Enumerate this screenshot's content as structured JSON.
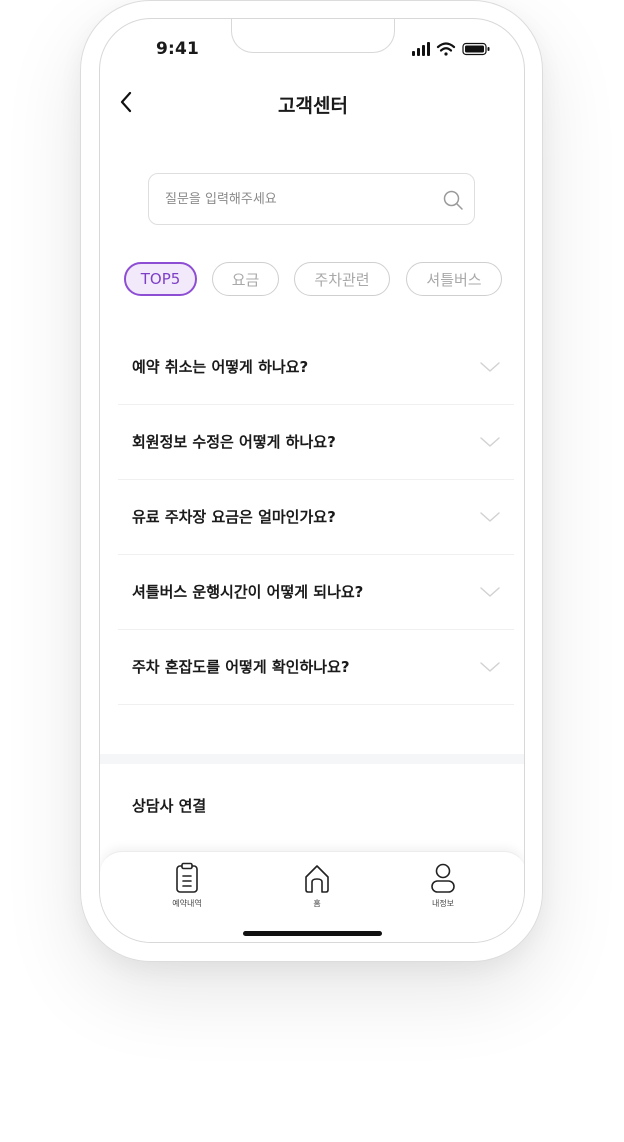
{
  "status_bar": {
    "time": "9:41"
  },
  "header": {
    "title": "고객센터"
  },
  "search": {
    "placeholder": "질문을 입력해주세요"
  },
  "chips": [
    {
      "label": "TOP5",
      "active": true
    },
    {
      "label": "요금",
      "active": false
    },
    {
      "label": "주차관련",
      "active": false
    },
    {
      "label": "셔틀버스",
      "active": false
    }
  ],
  "faqs": [
    {
      "question": "예약 취소는 어떻게 하나요?"
    },
    {
      "question": "회원정보 수정은 어떻게 하나요?"
    },
    {
      "question": "유료 주차장 요금은 얼마인가요?"
    },
    {
      "question": "셔틀버스 운행시간이 어떻게 되나요?"
    },
    {
      "question": "주차 혼잡도를 어떻게 확인하나요?"
    }
  ],
  "counselor": {
    "label": "상담사 연결"
  },
  "tab_bar": {
    "items": [
      {
        "label": "예약내역",
        "icon": "clipboard-icon"
      },
      {
        "label": "홈",
        "icon": "home-icon"
      },
      {
        "label": "내정보",
        "icon": "user-icon"
      }
    ]
  },
  "colors": {
    "accent": "#8e4ed3",
    "accent_bg": "#f2eafb",
    "chip_inactive": "#cfcfcf",
    "divider": "#f5f6f8"
  }
}
